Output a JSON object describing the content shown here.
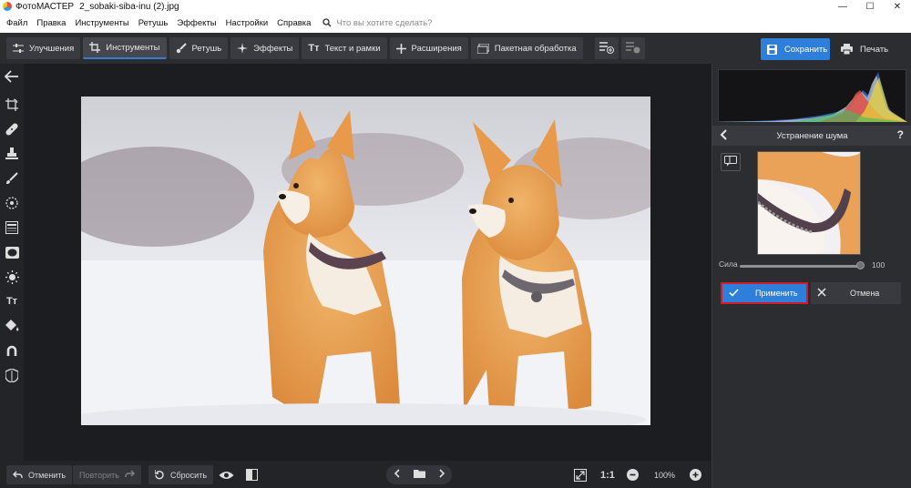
{
  "window": {
    "app_name": "ФотоМАСТЕР",
    "file_name": "2_sobaki-siba-inu (2).jpg",
    "controls": {
      "minimize": "—",
      "maximize": "☐",
      "close": "✕"
    }
  },
  "menu": {
    "items": [
      "Файл",
      "Правка",
      "Инструменты",
      "Ретушь",
      "Эффекты",
      "Настройки",
      "Справка"
    ],
    "search_placeholder": "Что вы хотите сделать?"
  },
  "toolbar": {
    "tabs": [
      {
        "label": "Улучшения",
        "icon": "sliders-icon",
        "active": false
      },
      {
        "label": "Инструменты",
        "icon": "crop-icon",
        "active": true
      },
      {
        "label": "Ретушь",
        "icon": "brush-icon",
        "active": false
      },
      {
        "label": "Эффекты",
        "icon": "sparkle-icon",
        "active": false
      },
      {
        "label": "Текст и рамки",
        "icon": "text-icon",
        "active": false
      },
      {
        "label": "Расширения",
        "icon": "plus-icon",
        "active": false
      },
      {
        "label": "Пакетная обработка",
        "icon": "batch-icon",
        "active": false
      }
    ],
    "save_label": "Сохранить",
    "print_label": "Печать"
  },
  "left_tools": [
    "back-arrow-icon",
    "rotate-icon",
    "healing-patch-icon",
    "stamp-icon",
    "brush-icon",
    "radial-filter-icon",
    "gradient-filter-icon",
    "vignette-icon",
    "light-icon",
    "text-icon",
    "fill-icon",
    "horseshoe-icon",
    "shield-icon"
  ],
  "panel": {
    "title": "Устранение шума",
    "back_icon": "chevron-left-icon",
    "help": "?",
    "strength_label": "Сила",
    "strength_value": "100",
    "strength_fraction": 1.0,
    "apply_label": "Применить",
    "cancel_label": "Отмена"
  },
  "bottom": {
    "undo_label": "Отменить",
    "redo_label": "Повторить",
    "reset_label": "Сбросить",
    "zoom_ratio": "1:1",
    "zoom_value": "100%"
  },
  "colors": {
    "accent": "#2e7fd9",
    "apply_outline": "#d01b2c",
    "panel_bg": "#2c2d31",
    "canvas_bg": "#1c1d20"
  }
}
